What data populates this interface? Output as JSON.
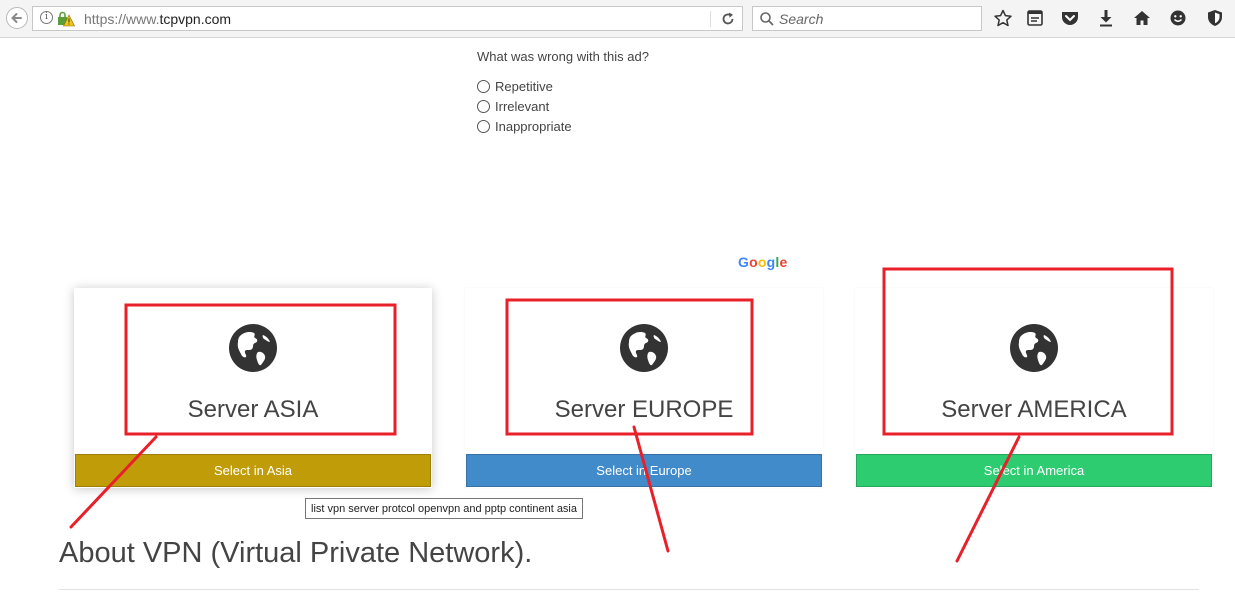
{
  "browser": {
    "url_prefix": "https://www.",
    "url_domain": "tcpvpn.com",
    "search_placeholder": "Search"
  },
  "ad_feedback": {
    "question": "What was wrong with this ad?",
    "options": [
      "Repetitive",
      "Irrelevant",
      "Inappropriate"
    ],
    "brand": "Google"
  },
  "servers": [
    {
      "title": "Server ASIA",
      "button": "Select in Asia",
      "color": "#c09c09",
      "icon": "globe-icon"
    },
    {
      "title": "Server EUROPE",
      "button": "Select in Europe",
      "color": "#428bca",
      "icon": "globe-icon"
    },
    {
      "title": "Server AMERICA",
      "button": "Select in America",
      "color": "#2ecc71",
      "icon": "globe-icon"
    }
  ],
  "tooltip": "list vpn server protcol openvpn and pptp continent asia",
  "about_heading": "About VPN (Virtual Private Network).",
  "colors": {
    "annotation_red": "#e8202a",
    "toolbar_bg": "#f4f4f4"
  }
}
